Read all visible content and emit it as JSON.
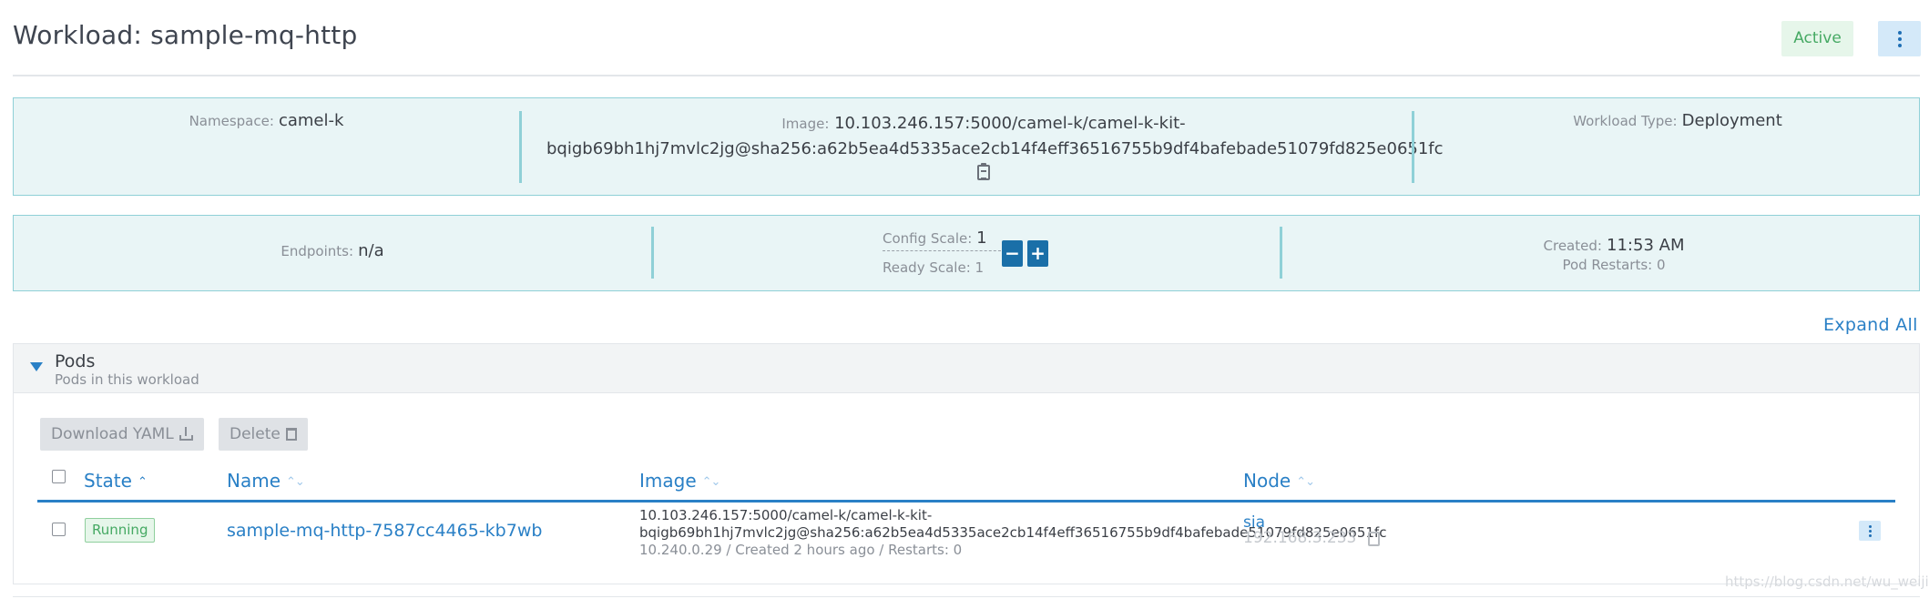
{
  "header": {
    "title": "Workload: sample-mq-http",
    "state": "Active"
  },
  "details": {
    "namespace_label": "Namespace:",
    "namespace": "camel-k",
    "image_label": "Image:",
    "image_line1": "10.103.246.157:5000/camel-k/camel-k-kit-",
    "image_line2": "bqigb69bh1hj7mvlc2jg@sha256:a62b5ea4d5335ace2cb14f4eff36516755b9df4bafebade51079fd825e0651fc",
    "workload_type_label": "Workload Type:",
    "workload_type": "Deployment"
  },
  "scale": {
    "endpoints_label": "Endpoints:",
    "endpoints": "n/a",
    "config_scale_label": "Config Scale:",
    "config_scale": "1",
    "ready_scale": "Ready Scale: 1",
    "decrease_label": "−",
    "increase_label": "+",
    "created_label": "Created:",
    "created": "11:53 AM",
    "pod_restarts": "Pod Restarts: 0"
  },
  "expand_all": "Expand All",
  "pods": {
    "title": "Pods",
    "subtitle": "Pods in this workload",
    "download_yaml": "Download YAML",
    "delete": "Delete",
    "columns": {
      "state": "State",
      "name": "Name",
      "image": "Image",
      "node": "Node"
    },
    "rows": [
      {
        "state": "Running",
        "name": "sample-mq-http-7587cc4465-kb7wb",
        "image_line1": "10.103.246.157:5000/camel-k/camel-k-kit-",
        "image_line2": "bqigb69bh1hj7mvlc2jg@sha256:a62b5ea4d5335ace2cb14f4eff36516755b9df4bafebade51079fd825e0651fc",
        "meta": "10.240.0.29 / Created 2 hours ago / Restarts: 0",
        "node": "sia",
        "node_ip": "192.168.3.233"
      }
    ]
  },
  "watermark": "https://blog.csdn.net/wu_weijie",
  "colors": {
    "accent": "#2a80c6",
    "info_box_bg": "#e9f5f6",
    "info_box_border": "#8fd0d7",
    "active_bg": "#e6f6ea",
    "active_text": "#45a963",
    "scale_button": "#1a6fa8"
  }
}
